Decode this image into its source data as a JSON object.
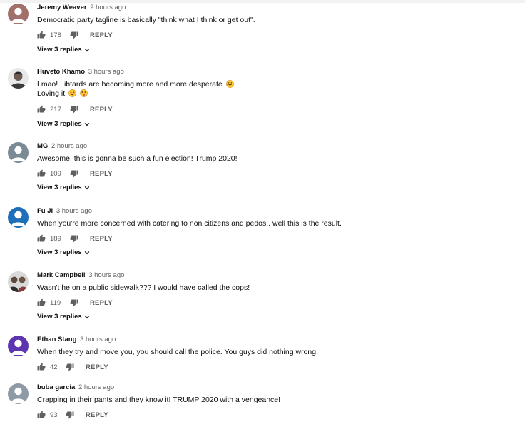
{
  "comments": [
    {
      "author": "Jeremy Weaver",
      "time": "2 hours ago",
      "lines": [
        "Democratic party tagline is basically \"think what I think or get out\"."
      ],
      "likes": "178",
      "reply_label": "REPLY",
      "view_replies": "View 3 replies",
      "avatar": {
        "type": "initial-blank",
        "color": "#a1706a"
      }
    },
    {
      "author": "Huveto Khamo",
      "time": "3 hours ago",
      "lines": [
        "Lmao! Libtards are becoming more and more desperate",
        "Loving it"
      ],
      "emojis_line1": [
        "rolling-on-floor-laughing-emoji"
      ],
      "emojis_line2": [
        "star-struck-emoji",
        "squinting-tongue-emoji"
      ],
      "likes": "217",
      "reply_label": "REPLY",
      "view_replies": "View 3 replies",
      "avatar": {
        "type": "photo",
        "color": "#555555"
      }
    },
    {
      "author": "MG",
      "time": "2 hours ago",
      "lines": [
        "Awesome, this is gonna be such a fun election!  Trump 2020!"
      ],
      "likes": "109",
      "reply_label": "REPLY",
      "view_replies": "View 3 replies",
      "avatar": {
        "type": "initial-blank",
        "color": "#7b8b96"
      }
    },
    {
      "author": "Fu Ji",
      "time": "3 hours ago",
      "lines": [
        "When you're more concerned with catering to non citizens and pedos.. well this is the result."
      ],
      "likes": "189",
      "reply_label": "REPLY",
      "view_replies": "View 3 replies",
      "avatar": {
        "type": "initial-blank",
        "color": "#1e6fba"
      }
    },
    {
      "author": "Mark Campbell",
      "time": "3 hours ago",
      "lines": [
        "Wasn't he on a public sidewalk??? I would have called the cops!"
      ],
      "likes": "119",
      "reply_label": "REPLY",
      "view_replies": "View 3 replies",
      "avatar": {
        "type": "photo",
        "color": "#4a4a4a"
      }
    },
    {
      "author": "Ethan Stang",
      "time": "3 hours ago",
      "lines": [
        "When they try and move you, you should call the police. You guys did nothing wrong."
      ],
      "likes": "42",
      "reply_label": "REPLY",
      "view_replies": "",
      "avatar": {
        "type": "initial-blank",
        "color": "#5e35b1"
      }
    },
    {
      "author": "buba garcia",
      "time": "2 hours ago",
      "lines": [
        "Crapping in their pants and they know it!  TRUMP 2020 with a vengeance!"
      ],
      "likes": "93",
      "reply_label": "REPLY",
      "view_replies": "",
      "avatar": {
        "type": "initial-blank",
        "color": "#8e9aa6"
      }
    }
  ],
  "icons": {
    "like": "thumbs-up-icon",
    "dislike": "thumbs-down-icon",
    "expand": "chevron-down-icon"
  },
  "colors": {
    "author_text": "#0f0f0f",
    "secondary_text": "#606060",
    "link_text": "#0f0f0f"
  }
}
